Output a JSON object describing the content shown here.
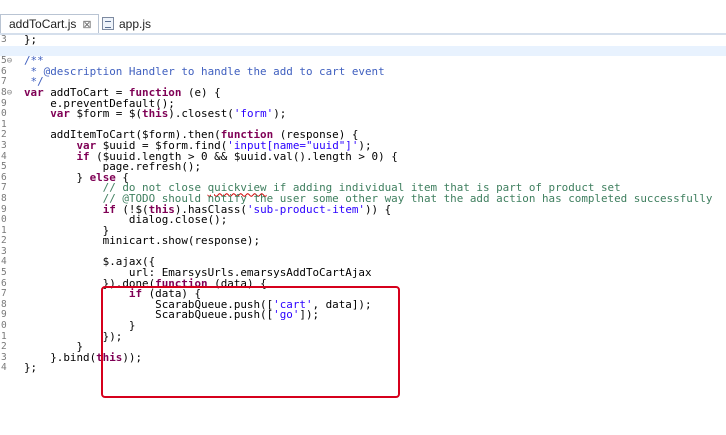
{
  "tabs": [
    {
      "label": "addToCart.js",
      "close": "⊠",
      "active": true
    },
    {
      "label": "app.js",
      "active": false
    }
  ],
  "editor": {
    "lines": [
      {
        "n": "3",
        "fold": "",
        "hl": false,
        "tokens": [
          {
            "t": "};",
            "c": ""
          }
        ]
      },
      {
        "n": "",
        "fold": "",
        "hl": true,
        "tokens": []
      },
      {
        "n": "5",
        "fold": "⊖",
        "hl": false,
        "tokens": [
          {
            "t": "/**",
            "c": "cmd"
          }
        ]
      },
      {
        "n": "6",
        "fold": "",
        "hl": false,
        "tokens": [
          {
            "t": " * @description Handler to handle the add to cart event",
            "c": "cmd"
          }
        ]
      },
      {
        "n": "7",
        "fold": "",
        "hl": false,
        "tokens": [
          {
            "t": " */",
            "c": "cmd"
          }
        ]
      },
      {
        "n": "8",
        "fold": "⊖",
        "hl": false,
        "tokens": [
          {
            "t": "var",
            "c": "kw"
          },
          {
            "t": " addToCart = ",
            "c": ""
          },
          {
            "t": "function",
            "c": "kw"
          },
          {
            "t": " (e) {",
            "c": ""
          }
        ]
      },
      {
        "n": "9",
        "fold": "",
        "hl": false,
        "tokens": [
          {
            "t": "    e.preventDefault();",
            "c": ""
          }
        ]
      },
      {
        "n": "0",
        "fold": "",
        "hl": false,
        "tokens": [
          {
            "t": "    ",
            "c": ""
          },
          {
            "t": "var",
            "c": "kw"
          },
          {
            "t": " $form = $(",
            "c": ""
          },
          {
            "t": "this",
            "c": "kw"
          },
          {
            "t": ").closest(",
            "c": ""
          },
          {
            "t": "'form'",
            "c": "str"
          },
          {
            "t": ");",
            "c": ""
          }
        ]
      },
      {
        "n": "1",
        "fold": "",
        "hl": false,
        "tokens": []
      },
      {
        "n": "2",
        "fold": "",
        "hl": false,
        "tokens": [
          {
            "t": "    addItemToCart($form).then(",
            "c": ""
          },
          {
            "t": "function",
            "c": "kw"
          },
          {
            "t": " (response) {",
            "c": ""
          }
        ]
      },
      {
        "n": "3",
        "fold": "",
        "hl": false,
        "tokens": [
          {
            "t": "        ",
            "c": ""
          },
          {
            "t": "var",
            "c": "kw"
          },
          {
            "t": " $uuid = $form.find(",
            "c": ""
          },
          {
            "t": "'input[name=\"uuid\"]'",
            "c": "str"
          },
          {
            "t": ");",
            "c": ""
          }
        ]
      },
      {
        "n": "4",
        "fold": "",
        "hl": false,
        "tokens": [
          {
            "t": "        ",
            "c": ""
          },
          {
            "t": "if",
            "c": "kw"
          },
          {
            "t": " ($uuid.length > 0 && $uuid.val().length > 0) {",
            "c": ""
          }
        ]
      },
      {
        "n": "5",
        "fold": "",
        "hl": false,
        "tokens": [
          {
            "t": "            page.refresh();",
            "c": ""
          }
        ]
      },
      {
        "n": "6",
        "fold": "",
        "hl": false,
        "tokens": [
          {
            "t": "        } ",
            "c": ""
          },
          {
            "t": "else",
            "c": "kw"
          },
          {
            "t": " {",
            "c": ""
          }
        ]
      },
      {
        "n": "7",
        "fold": "",
        "hl": false,
        "tokens": [
          {
            "t": "            // do not close ",
            "c": "cm"
          },
          {
            "t": "quickview",
            "c": "cm sq"
          },
          {
            "t": " if adding individual item that is part of product set",
            "c": "cm"
          }
        ]
      },
      {
        "n": "8",
        "fold": "",
        "hl": false,
        "tokens": [
          {
            "t": "            // @TODO should notify the user some other way that the add action has completed successfully",
            "c": "cm"
          }
        ]
      },
      {
        "n": "9",
        "fold": "",
        "hl": false,
        "tokens": [
          {
            "t": "            ",
            "c": ""
          },
          {
            "t": "if",
            "c": "kw"
          },
          {
            "t": " (!$(",
            "c": ""
          },
          {
            "t": "this",
            "c": "kw"
          },
          {
            "t": ").hasClass(",
            "c": ""
          },
          {
            "t": "'sub-product-item'",
            "c": "str"
          },
          {
            "t": ")) {",
            "c": ""
          }
        ]
      },
      {
        "n": "0",
        "fold": "",
        "hl": false,
        "tokens": [
          {
            "t": "                dialog.close();",
            "c": ""
          }
        ]
      },
      {
        "n": "1",
        "fold": "",
        "hl": false,
        "tokens": [
          {
            "t": "            }",
            "c": ""
          }
        ]
      },
      {
        "n": "2",
        "fold": "",
        "hl": false,
        "tokens": [
          {
            "t": "            minicart.show(response);",
            "c": ""
          }
        ]
      },
      {
        "n": "3",
        "fold": "",
        "hl": false,
        "tokens": []
      },
      {
        "n": "4",
        "fold": "",
        "hl": false,
        "tokens": [
          {
            "t": "            $.ajax({",
            "c": ""
          }
        ]
      },
      {
        "n": "5",
        "fold": "",
        "hl": false,
        "tokens": [
          {
            "t": "                url: EmarsysUrls.emarsysAddToCartAjax",
            "c": ""
          }
        ]
      },
      {
        "n": "6",
        "fold": "",
        "hl": false,
        "tokens": [
          {
            "t": "            }).done(",
            "c": ""
          },
          {
            "t": "function",
            "c": "kw"
          },
          {
            "t": " (data) {",
            "c": ""
          }
        ]
      },
      {
        "n": "7",
        "fold": "",
        "hl": false,
        "tokens": [
          {
            "t": "                ",
            "c": ""
          },
          {
            "t": "if",
            "c": "kw"
          },
          {
            "t": " (data) {",
            "c": ""
          }
        ]
      },
      {
        "n": "8",
        "fold": "",
        "hl": false,
        "tokens": [
          {
            "t": "                    ScarabQueue.push([",
            "c": ""
          },
          {
            "t": "'cart'",
            "c": "str"
          },
          {
            "t": ", data]);",
            "c": ""
          }
        ]
      },
      {
        "n": "9",
        "fold": "",
        "hl": false,
        "tokens": [
          {
            "t": "                    ScarabQueue.push([",
            "c": ""
          },
          {
            "t": "'go'",
            "c": "str"
          },
          {
            "t": "]);",
            "c": ""
          }
        ]
      },
      {
        "n": "0",
        "fold": "",
        "hl": false,
        "tokens": [
          {
            "t": "                }",
            "c": ""
          }
        ]
      },
      {
        "n": "1",
        "fold": "",
        "hl": false,
        "tokens": [
          {
            "t": "            });",
            "c": ""
          }
        ]
      },
      {
        "n": "2",
        "fold": "",
        "hl": false,
        "tokens": [
          {
            "t": "        }",
            "c": ""
          }
        ]
      },
      {
        "n": "3",
        "fold": "",
        "hl": false,
        "tokens": [
          {
            "t": "    }.bind(",
            "c": ""
          },
          {
            "t": "this",
            "c": "kw"
          },
          {
            "t": "));",
            "c": ""
          }
        ]
      },
      {
        "n": "4",
        "fold": "",
        "hl": false,
        "tokens": [
          {
            "t": "};",
            "c": ""
          }
        ]
      }
    ]
  },
  "colors": {
    "keyword": "#7f0055",
    "string": "#2a00ff",
    "comment": "#3f7f5f",
    "doc_comment": "#3f5fbf",
    "annotation_box": "#d6001c"
  }
}
